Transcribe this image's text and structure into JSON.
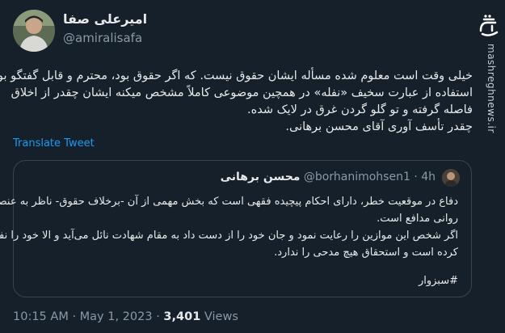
{
  "tweet": {
    "author_name": "امیرعلی صفا",
    "author_handle": "@amiralisafa",
    "lines": [
      "خیلی وقت است معلوم شده مسأله ایشان حقوق نیست. که اگر حقوق بود، محترم و قابل گفتگو بود.",
      "استفاده از عبارت سخیف «نفله» در همچین موضوعی کاملاً مشخص میکنه ایشان چقدر از اخلاق",
      "فاصله گرفته و تو گلو گردن غرق در لایک شده.",
      "چقدر تأسف آوری آقای محسن برهانی."
    ],
    "translate_label": "Translate Tweet",
    "time": "10:15 AM",
    "separator": "·",
    "date": "May 1, 2023",
    "views_count": "3,401",
    "views_label": "Views"
  },
  "quote": {
    "name": "محسن برهانی",
    "handle": "@borhanimohsen1",
    "separator": "·",
    "age": "4h",
    "lines": [
      "دفاع در موقعیت خطر، دارای احکام پیچیده فقهی است که بخش مهمی از آن -برخلاف حقوق- ناظر به عنصر",
      "روانی مدافع است.",
      "اگر شخص این موازین را رعایت نمود و جان خود را از دست داد به مقام شهادت نائل می‌آید و الا خود را نفله",
      "کرده است و استحقاق هیچ مدحی را ندارد."
    ],
    "hashtag": "#سبزوار"
  },
  "watermark": {
    "logo_text": "مشرق",
    "site": "mashreghnews.ir"
  },
  "colors": {
    "background": "#15202b",
    "text": "#e7e9ea",
    "secondary": "#8b98a5",
    "link": "#1d9bf0",
    "border": "#38444d"
  }
}
